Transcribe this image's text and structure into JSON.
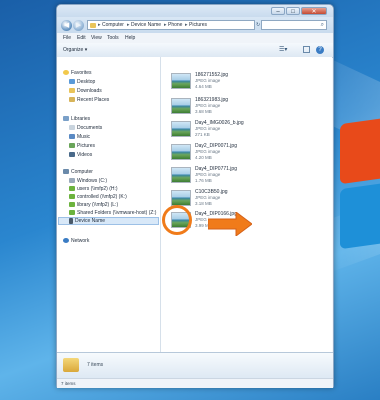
{
  "window": {
    "address": {
      "crumbs": [
        "Computer",
        "Device Name",
        "Phone",
        "Pictures"
      ]
    },
    "menu": [
      "File",
      "Edit",
      "View",
      "Tools",
      "Help"
    ],
    "toolbar": {
      "organize": "Organize"
    },
    "nav": {
      "favorites": {
        "header": "Favorites",
        "items": [
          "Desktop",
          "Downloads",
          "Recent Places"
        ]
      },
      "libraries": {
        "header": "Libraries",
        "items": [
          "Documents",
          "Music",
          "Pictures",
          "Videos"
        ]
      },
      "computer": {
        "header": "Computer",
        "items": [
          "Windows (C:)",
          "users (\\\\mfp2) (H:)",
          "controlled (\\\\mfp2) (K:)",
          "library (\\\\mfp2) (L:)",
          "Shared Folders (\\\\vmware-host) (Z:)",
          "Device Name"
        ]
      },
      "network": {
        "header": "Network"
      }
    },
    "files": [
      {
        "name": "186271552.jpg",
        "type": "JPEG image",
        "size": "4.64 MB"
      },
      {
        "name": "186321983.jpg",
        "type": "JPEG image",
        "size": "3.68 MB"
      },
      {
        "name": "Day4_IMG0026_b.jpg",
        "type": "JPEG image",
        "size": "271 KB"
      },
      {
        "name": "Day2_DIP0071.jpg",
        "type": "JPEG image",
        "size": "4.20 MB"
      },
      {
        "name": "Day4_DIP0771.jpg",
        "type": "JPEG image",
        "size": "1.76 MB"
      },
      {
        "name": "C10C3B50.jpg",
        "type": "JPEG image",
        "size": "3.18 MB"
      },
      {
        "name": "Day4_DIP0166.jpg",
        "type": "JPEG image",
        "size": "3.99 MB"
      }
    ],
    "details": {
      "count": "7 items"
    },
    "status": {
      "count": "7 items"
    }
  },
  "colors": {
    "highlight": "#f07b1a",
    "selection": "#d8e8f8"
  }
}
